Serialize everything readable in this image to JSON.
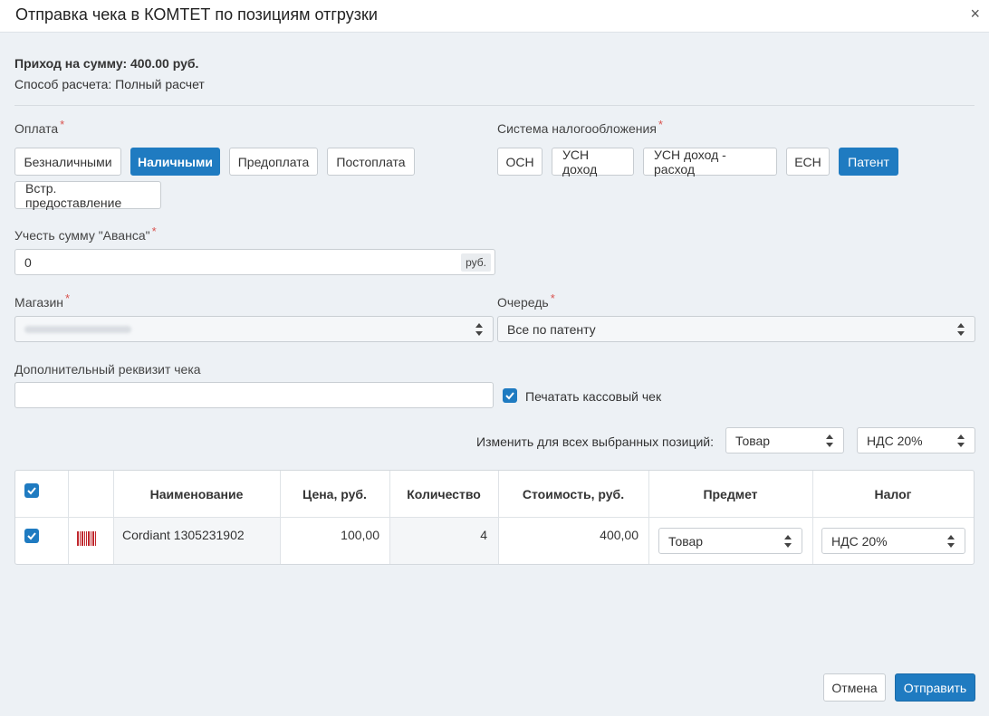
{
  "dialog": {
    "title": "Отправка чека в КОМТЕТ по позициям отгрузки",
    "close": "×"
  },
  "summary": {
    "income": "Приход на сумму: 400.00 руб.",
    "method": "Способ расчета: Полный расчет"
  },
  "payment": {
    "label": "Оплата",
    "required": "*",
    "options": [
      "Безналичными",
      "Наличными",
      "Предоплата",
      "Постоплата",
      "Встр. предоставление"
    ],
    "selected": "Наличными"
  },
  "tax_system": {
    "label": "Система налогообложения",
    "required": "*",
    "options": [
      "ОСН",
      "УСН доход",
      "УСН доход - расход",
      "ЕСН",
      "Патент"
    ],
    "selected": "Патент"
  },
  "advance": {
    "label": "Учесть сумму \"Аванса\"",
    "required": "*",
    "value": "0",
    "unit": "руб."
  },
  "store": {
    "label": "Магазин",
    "required": "*"
  },
  "queue": {
    "label": "Очередь",
    "required": "*",
    "value": "Все по патенту"
  },
  "extra": {
    "label": "Дополнительный реквизит чека",
    "value": ""
  },
  "print_receipt": {
    "label": "Печатать кассовый чек",
    "checked": true
  },
  "bulk": {
    "label": "Изменить для всех выбранных позиций:",
    "subject": "Товар",
    "tax": "НДС 20%"
  },
  "table": {
    "headers": [
      "Наименование",
      "Цена, руб.",
      "Количество",
      "Стоимость, руб.",
      "Предмет",
      "Налог"
    ],
    "rows": [
      {
        "name": "Cordiant 1305231902",
        "price": "100,00",
        "qty": "4",
        "cost": "400,00",
        "subject": "Товар",
        "tax": "НДС 20%",
        "checked": true
      }
    ]
  },
  "footer": {
    "cancel": "Отмена",
    "submit": "Отправить"
  },
  "colors": {
    "accent": "#1f7bc1",
    "required": "#d9534f",
    "background": "#edf1f5"
  }
}
